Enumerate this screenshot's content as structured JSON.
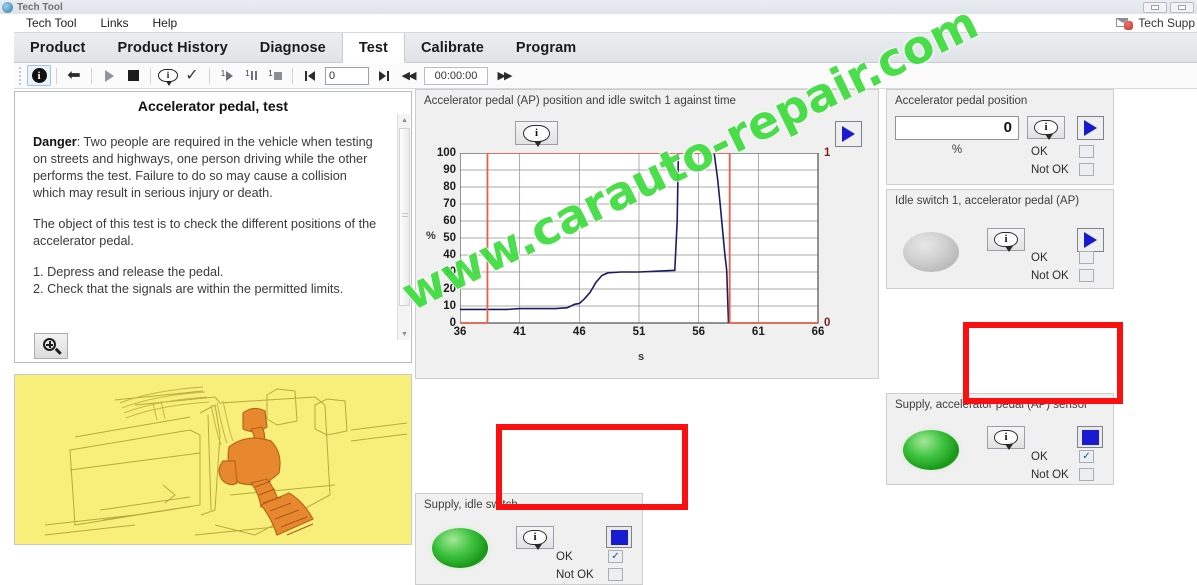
{
  "window": {
    "title": "Tech Tool",
    "app_icon": "app-globe-icon",
    "buttons": [
      "minimize",
      "maximize"
    ]
  },
  "menubar": {
    "items": [
      "Tech Tool",
      "Links",
      "Help"
    ],
    "tech_support": {
      "label": "Tech Supp",
      "icon": "tech-support-icon"
    }
  },
  "tabs": [
    {
      "label": "Product",
      "active": false
    },
    {
      "label": "Product History",
      "active": false
    },
    {
      "label": "Diagnose",
      "active": false
    },
    {
      "label": "Test",
      "active": true
    },
    {
      "label": "Calibrate",
      "active": false
    },
    {
      "label": "Program",
      "active": false
    }
  ],
  "toolbar": {
    "info_label": "i",
    "bubble_label": "i",
    "step_marks": [
      "1",
      "1",
      "1"
    ],
    "counter_value": "0",
    "time_value": "00:00:00"
  },
  "document": {
    "title": "Accelerator pedal, test",
    "danger_label": "Danger",
    "danger_text": ": Two people are required in the vehicle when testing on streets and highways, one person driving while the other performs the test. Failure to do so may cause a collision which may result in serious injury or death.",
    "object_text": "The object of this test is to check the different positions of the accelerator pedal.",
    "step1": "1. Depress and release the pedal.",
    "step2": "2. Check that the signals are within the permitted limits.",
    "zoom_button": "zoom-in-icon"
  },
  "chart_panel": {
    "title": "Accelerator pedal (AP) position and idle switch 1 against time",
    "info_button": "info-bubble-icon",
    "play_button": "play-icon"
  },
  "chart_data": {
    "type": "line",
    "title": "Accelerator pedal (AP) position and idle switch 1 against time",
    "xlabel": "s",
    "ylabel": "%",
    "xlim": [
      36,
      66
    ],
    "ylim": [
      0,
      100
    ],
    "xticks": [
      36,
      41,
      46,
      51,
      56,
      61,
      66
    ],
    "yticks": [
      0,
      10,
      20,
      30,
      40,
      50,
      60,
      70,
      80,
      90,
      100
    ],
    "y2label": "",
    "y2lim": [
      0,
      1
    ],
    "y2ticks": [
      0,
      1
    ],
    "grid": true,
    "legend": "none",
    "series": [
      {
        "name": "Accelerator pedal (AP) position",
        "color": "#1b1b66",
        "axis": "left",
        "units": "%",
        "points": [
          [
            36.0,
            8
          ],
          [
            37.0,
            8
          ],
          [
            38.0,
            8
          ],
          [
            39.0,
            8
          ],
          [
            40.0,
            8
          ],
          [
            41.0,
            8.5
          ],
          [
            42.0,
            8.5
          ],
          [
            43.0,
            8.5
          ],
          [
            44.0,
            8.5
          ],
          [
            45.0,
            9
          ],
          [
            45.6,
            11
          ],
          [
            46.0,
            11.5
          ],
          [
            46.4,
            14
          ],
          [
            46.9,
            18
          ],
          [
            47.4,
            24
          ],
          [
            47.9,
            28
          ],
          [
            48.4,
            29.5
          ],
          [
            49.5,
            30
          ],
          [
            51.0,
            30
          ],
          [
            52.5,
            30.5
          ],
          [
            54.0,
            31
          ],
          [
            54.2,
            60
          ],
          [
            54.3,
            100
          ],
          [
            55.0,
            100
          ],
          [
            55.5,
            100
          ],
          [
            56.2,
            100
          ],
          [
            56.6,
            100
          ],
          [
            57.0,
            100
          ],
          [
            57.3,
            100
          ],
          [
            57.6,
            84
          ],
          [
            57.8,
            70
          ],
          [
            58.0,
            55
          ],
          [
            58.2,
            40
          ],
          [
            58.35,
            31
          ],
          [
            58.45,
            10
          ],
          [
            58.5,
            0
          ]
        ]
      },
      {
        "name": "Idle switch 1 (AP)",
        "color": "#e8604c",
        "axis": "right",
        "units": "",
        "points": [
          [
            36.0,
            0
          ],
          [
            38.3,
            0
          ],
          [
            38.3,
            1
          ],
          [
            58.6,
            1
          ],
          [
            58.6,
            0.31
          ],
          [
            58.6,
            0
          ],
          [
            66.0,
            0
          ]
        ]
      }
    ]
  },
  "panels": {
    "ap_position": {
      "title": "Accelerator pedal position",
      "value": "0",
      "unit": "%",
      "ok_label": "OK",
      "not_ok_label": "Not OK",
      "ok_checked": false,
      "not_ok_checked": false,
      "info_button": "info-bubble-icon",
      "play_button": "play-icon"
    },
    "idle_switch": {
      "title": "Idle switch 1, accelerator pedal (AP)",
      "lamp": "grey",
      "ok_label": "OK",
      "not_ok_label": "Not OK",
      "ok_checked": false,
      "not_ok_checked": false,
      "info_button": "info-bubble-icon",
      "play_button": "play-icon"
    },
    "supply_ap_sensor": {
      "title": "Supply, accelerator pedal (AP) sensor",
      "lamp": "green",
      "ok_label": "OK",
      "not_ok_label": "Not OK",
      "ok_checked": true,
      "not_ok_checked": false,
      "info_button": "info-bubble-icon",
      "swatch_color": "#1a1ad0",
      "highlighted": true
    },
    "supply_idle_switch": {
      "title": "Supply, idle switch",
      "lamp": "green",
      "ok_label": "OK",
      "not_ok_label": "Not OK",
      "ok_checked": true,
      "not_ok_checked": false,
      "info_button": "info-bubble-icon",
      "swatch_color": "#1a1ad0",
      "highlighted": true
    }
  },
  "highlight_color": "#fa1010",
  "watermark": "www.carauto-repair.com"
}
